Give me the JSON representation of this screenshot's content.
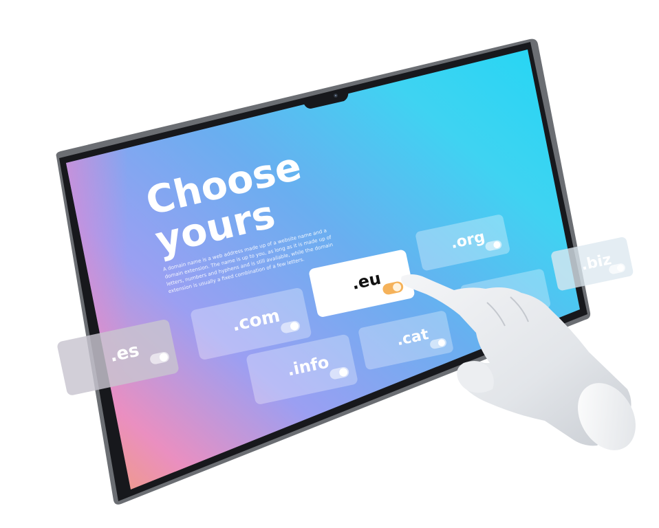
{
  "headline": {
    "line1": "Choose",
    "line2": "yours"
  },
  "description": [
    "A domain name is a web address made up of a website name and a",
    "domain extension. The name is up to you, as long as it is made up of",
    "letters, numbers and hyphens and is still available, while the domain",
    "extension is usually a fixed combination of a few letters."
  ],
  "domains": {
    "es": ".es",
    "com": ".com",
    "info": ".info",
    "eu": ".eu",
    "cat": ".cat",
    "org": ".org",
    "biz": ".biz"
  },
  "colors": {
    "screen_gradient": [
      "#f2a06e",
      "#ea8fc0",
      "#9b9ff2",
      "#6aaef0",
      "#3fd3f2",
      "#22d6f4"
    ],
    "bezel": "#17181c",
    "frame": "#6b6e73",
    "card_glass": "#ffffff",
    "card_text": "#ffffff",
    "selected_card_text": "#111111",
    "toggle_on": "#f5b25a",
    "hand": "#e9ebee"
  },
  "icons": {
    "camera": "front-camera-icon",
    "hand": "pointing-hand-icon"
  }
}
